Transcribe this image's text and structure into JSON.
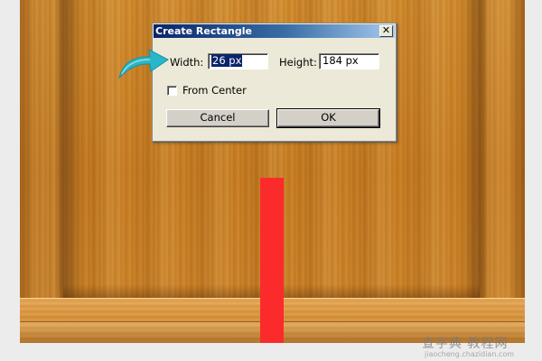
{
  "dialog": {
    "title": "Create Rectangle",
    "close_glyph": "✕",
    "width_label": "Width:",
    "width_value": "26 px",
    "height_label": "Height:",
    "height_value": "184 px",
    "from_center_label": "From Center",
    "from_center_checked": false,
    "cancel_label": "Cancel",
    "ok_label": "OK"
  },
  "annotation": {
    "arrow_color": "#27b7c9",
    "icon": "curved-arrow-icon"
  },
  "canvas": {
    "rectangle_color": "#fb2b2b",
    "wood_color": "#c97d22"
  },
  "watermark": {
    "main": "查字典 教程网",
    "sub": "jiaocheng.chazidian.com"
  }
}
